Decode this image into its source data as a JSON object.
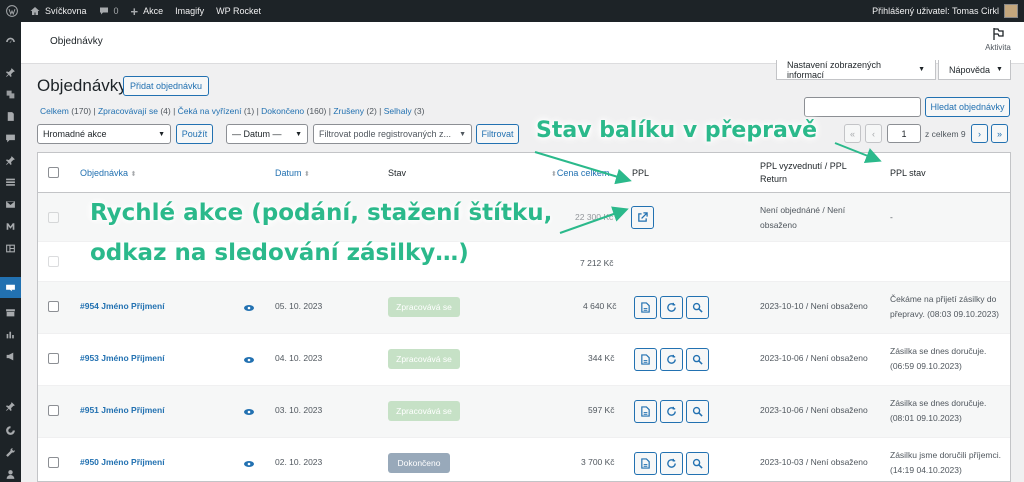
{
  "adminbar": {
    "site": "Svíčkovna",
    "comments": "0",
    "new": "Akce",
    "imagify": "Imagify",
    "wprocket": "WP Rocket",
    "user": "Přihlášený uživatel: Tomas Cirkl"
  },
  "header": {
    "title": "Objednávky",
    "activity": "Aktivita"
  },
  "tabs": {
    "screen_options": "Nastavení zobrazených informací",
    "help": "Nápověda"
  },
  "page": {
    "heading": "Objednávky",
    "add_button": "Přidat objednávku"
  },
  "views": [
    {
      "label": "Celkem",
      "count": "(170)"
    },
    {
      "label": "Zpracovávají se",
      "count": "(4)"
    },
    {
      "label": "Čeká na vyřízení",
      "count": "(1)"
    },
    {
      "label": "Dokončeno",
      "count": "(160)"
    },
    {
      "label": "Zrušeny",
      "count": "(2)"
    },
    {
      "label": "Selhaly",
      "count": "(3)"
    }
  ],
  "search": {
    "button": "Hledat objednávky",
    "value": ""
  },
  "filters": {
    "bulk_action": "Hromadné akce",
    "apply": "Použít",
    "date": "— Datum —",
    "customer_placeholder": "Filtrovat podle registrovaných z...",
    "filter": "Filtrovat"
  },
  "pagination": {
    "first": "«",
    "prev": "‹",
    "page": "1",
    "total": "z celkem 9",
    "next": "›",
    "last": "»"
  },
  "columns": {
    "order": "Objednávka",
    "date": "Datum",
    "status": "Stav",
    "total": "Cena celkem",
    "ppl": "PPL",
    "ppl_pickup": "PPL vyzvednutí / PPL Return",
    "ppl_status": "PPL stav"
  },
  "rows": [
    {
      "order": "",
      "date": "",
      "status": "",
      "total": "22 300 Kč",
      "pickup": "Není objednáné / Není obsaženo",
      "ppl_status": "-"
    },
    {
      "order": "",
      "date": "",
      "status": "",
      "total": "7 212 Kč",
      "pickup": "",
      "ppl_status": ""
    },
    {
      "order": "#954 Jméno Příjmení",
      "date": "05. 10. 2023",
      "status": "Zpracovává se",
      "total": "4 640 Kč",
      "pickup": "2023-10-10 / Není obsaženo",
      "ppl_status": "Čekáme na přijetí zásilky do přepravy. (08:03 09.10.2023)"
    },
    {
      "order": "#953 Jméno Příjmení",
      "date": "04. 10. 2023",
      "status": "Zpracovává se",
      "total": "344 Kč",
      "pickup": "2023-10-06 / Není obsaženo",
      "ppl_status": "Zásilka se dnes doručuje. (06:59 09.10.2023)"
    },
    {
      "order": "#951 Jméno Příjmení",
      "date": "03. 10. 2023",
      "status": "Zpracovává se",
      "total": "597 Kč",
      "pickup": "2023-10-06 / Není obsaženo",
      "ppl_status": "Zásilka se dnes doručuje. (08:01 09.10.2023)"
    },
    {
      "order": "#950 Jméno Příjmení",
      "date": "02. 10. 2023",
      "status": "Dokončeno",
      "total": "3 700 Kč",
      "pickup": "2023-10-03 / Není obsaženo",
      "ppl_status": "Zásilku jsme doručili příjemci. (14:19 04.10.2023)"
    }
  ],
  "annotations": {
    "status": "Stav balíku v přepravě",
    "actions_line1": "Rychlé akce (podání, stažení štítku,",
    "actions_line2": "odkaz na sledování zásilky…)"
  },
  "colors": {
    "accent": "#2271b1",
    "annotation": "#2bb98b",
    "processing": "#c6e1c6",
    "completed": "#98a9ba"
  }
}
